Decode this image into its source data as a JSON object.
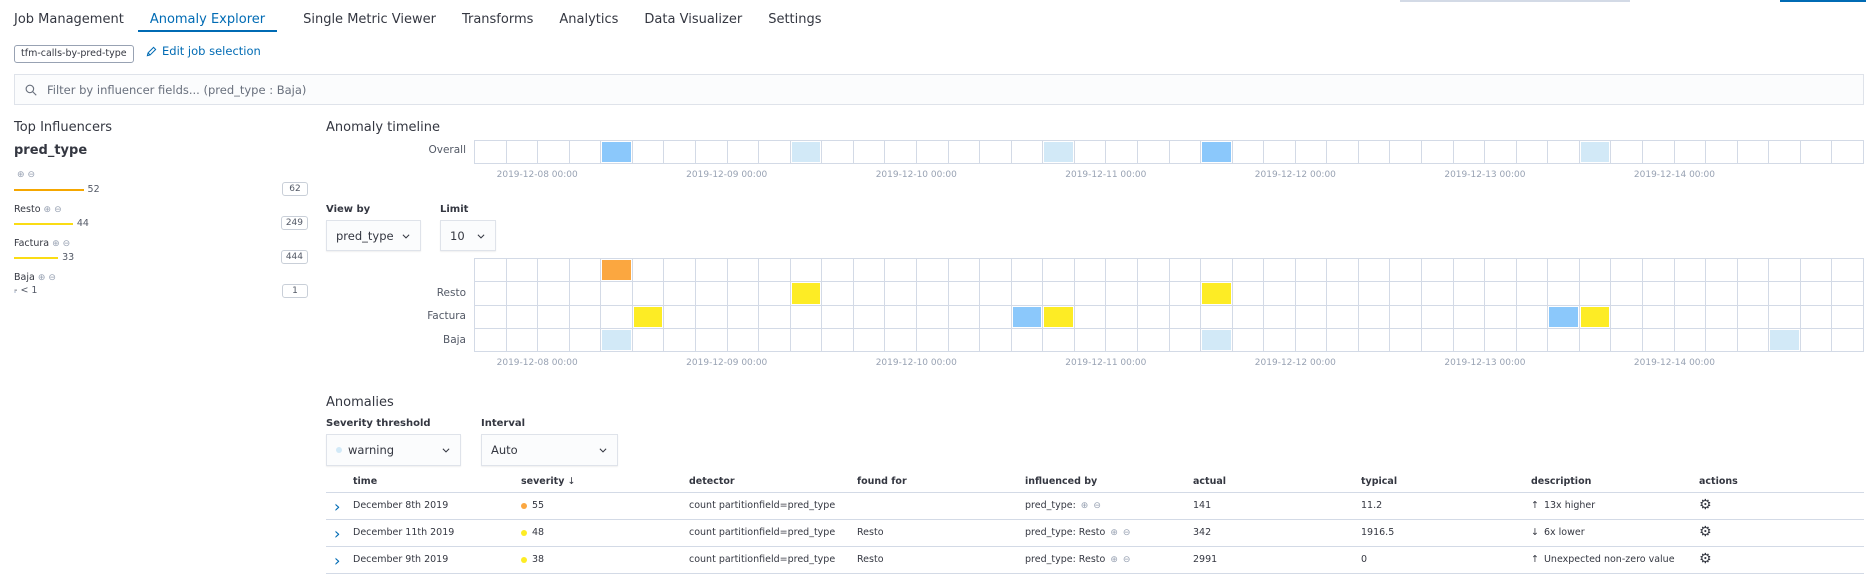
{
  "tabs": [
    "Job Management",
    "Anomaly Explorer",
    "Single Metric Viewer",
    "Transforms",
    "Analytics",
    "Data Visualizer",
    "Settings"
  ],
  "active_tab": 1,
  "job": {
    "id": "tfm-calls-by-pred-type",
    "edit_label": "Edit job selection"
  },
  "filter": {
    "placeholder": "Filter by influencer fields... (pred_type : Baja)"
  },
  "influencers": {
    "title": "Top Influencers",
    "field": "pred_type",
    "items": [
      {
        "label": "",
        "score_label": "52",
        "score": 52,
        "count": "62",
        "color": "#f5a700"
      },
      {
        "label": "Resto",
        "score_label": "44",
        "score": 44,
        "count": "249",
        "color": "#fadc14"
      },
      {
        "label": "Factura",
        "score_label": "33",
        "score": 33,
        "count": "444",
        "color": "#fadc14"
      },
      {
        "label": "Baja",
        "score_label": "< 1",
        "score": 0.5,
        "count": "1",
        "color": "#d3dae6"
      }
    ]
  },
  "timeline": {
    "title": "Anomaly timeline",
    "overall_label": "Overall",
    "columns": 44,
    "date_labels": [
      "2019-12-08 00:00",
      "2019-12-09 00:00",
      "2019-12-10 00:00",
      "2019-12-11 00:00",
      "2019-12-12 00:00",
      "2019-12-13 00:00",
      "2019-12-14 00:00"
    ],
    "overall_cells": [
      {
        "col": 4,
        "color": "#8bc8fb"
      },
      {
        "col": 10,
        "color": "#d2e9f7"
      },
      {
        "col": 18,
        "color": "#d2e9f7"
      },
      {
        "col": 23,
        "color": "#8bc8fb"
      },
      {
        "col": 35,
        "color": "#d2e9f7"
      }
    ],
    "view_by_label": "View by",
    "view_by_value": "pred_type",
    "limit_label": "Limit",
    "limit_value": "10",
    "swimlanes": [
      {
        "label": "",
        "cells": [
          {
            "col": 4,
            "color": "#fba740"
          }
        ]
      },
      {
        "label": "Resto",
        "cells": [
          {
            "col": 10,
            "color": "#fdec25"
          },
          {
            "col": 23,
            "color": "#fdec25"
          }
        ]
      },
      {
        "label": "Factura",
        "cells": [
          {
            "col": 5,
            "color": "#fdec25"
          },
          {
            "col": 17,
            "color": "#8bc8fb"
          },
          {
            "col": 18,
            "color": "#fdec25"
          },
          {
            "col": 34,
            "color": "#8bc8fb"
          },
          {
            "col": 35,
            "color": "#fdec25"
          }
        ]
      },
      {
        "label": "Baja",
        "cells": [
          {
            "col": 4,
            "color": "#d2e9f7"
          },
          {
            "col": 23,
            "color": "#d2e9f7"
          },
          {
            "col": 41,
            "color": "#d2e9f7"
          }
        ]
      }
    ]
  },
  "anomalies": {
    "title": "Anomalies",
    "severity_label": "Severity threshold",
    "severity_value": "warning",
    "interval_label": "Interval",
    "interval_value": "Auto",
    "columns": [
      "time",
      "severity",
      "detector",
      "found for",
      "influenced by",
      "actual",
      "typical",
      "description",
      "actions"
    ],
    "rows": [
      {
        "time": "December 8th 2019",
        "severity": "55",
        "severity_color": "#fba740",
        "detector": "count partitionfield=pred_type",
        "found_for": "",
        "influenced_by": "pred_type:",
        "actual": "141",
        "typical": "11.2",
        "direction": "up",
        "description": "13x higher"
      },
      {
        "time": "December 11th 2019",
        "severity": "48",
        "severity_color": "#fdec25",
        "detector": "count partitionfield=pred_type",
        "found_for": "Resto",
        "influenced_by": "pred_type: Resto",
        "actual": "342",
        "typical": "1916.5",
        "direction": "down",
        "description": "6x lower"
      },
      {
        "time": "December 9th 2019",
        "severity": "38",
        "severity_color": "#fdec25",
        "detector": "count partitionfield=pred_type",
        "found_for": "Resto",
        "influenced_by": "pred_type: Resto",
        "actual": "2991",
        "typical": "0",
        "direction": "up",
        "description": "Unexpected non-zero value"
      }
    ]
  }
}
